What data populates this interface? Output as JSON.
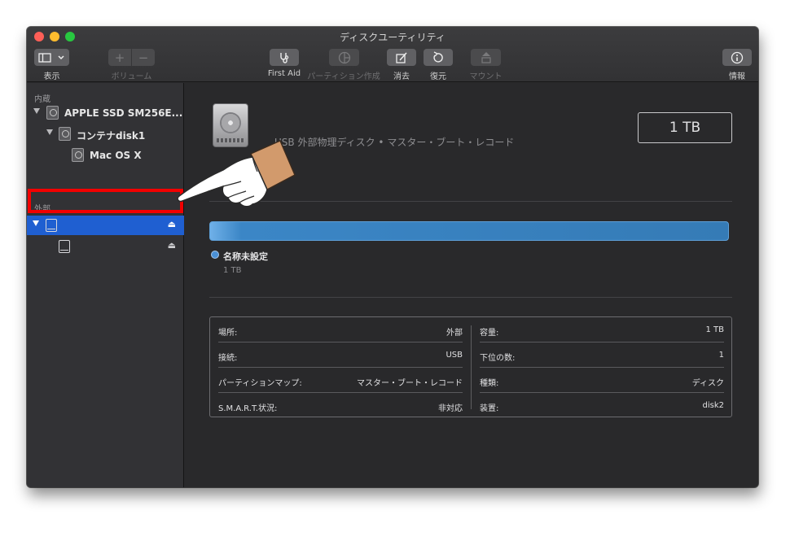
{
  "window": {
    "title": "ディスクユーティリティ"
  },
  "toolbar": {
    "view_label": "表示",
    "volume_label": "ボリューム",
    "volume_add": "+",
    "volume_remove": "−",
    "firstaid_label": "First Aid",
    "partition_label": "パーティション作成",
    "erase_label": "消去",
    "restore_label": "復元",
    "mount_label": "マウント",
    "info_label": "情報"
  },
  "sidebar": {
    "internal_title": "内蔵",
    "external_title": "外部",
    "items": [
      {
        "label": "APPLE SSD SM256E..."
      },
      {
        "label": "コンテナdisk1"
      },
      {
        "label": "Mac OS X"
      }
    ],
    "external_items": [
      {
        "label": ""
      },
      {
        "label": ""
      }
    ],
    "eject_glyph": "⏏"
  },
  "main": {
    "description": "USB 外部物理ディスク • マスター・ブート・レコード",
    "size": "1 TB",
    "partition": {
      "name": "名称未設定",
      "size": "1 TB",
      "color": "#3b86c6"
    },
    "info": {
      "left": [
        {
          "key": "場所:",
          "value": "外部"
        },
        {
          "key": "接続:",
          "value": "USB"
        },
        {
          "key": "パーティションマップ:",
          "value": "マスター・ブート・レコード"
        },
        {
          "key": "S.M.A.R.T.状況:",
          "value": "非対応"
        }
      ],
      "right": [
        {
          "key": "容量:",
          "value": "1 TB"
        },
        {
          "key": "下位の数:",
          "value": "1"
        },
        {
          "key": "種類:",
          "value": "ディスク"
        },
        {
          "key": "装置:",
          "value": "disk2"
        }
      ]
    }
  },
  "colors": {
    "selection": "#1f5fd1",
    "highlight": "#f20000",
    "hand": "#d29a6c"
  }
}
